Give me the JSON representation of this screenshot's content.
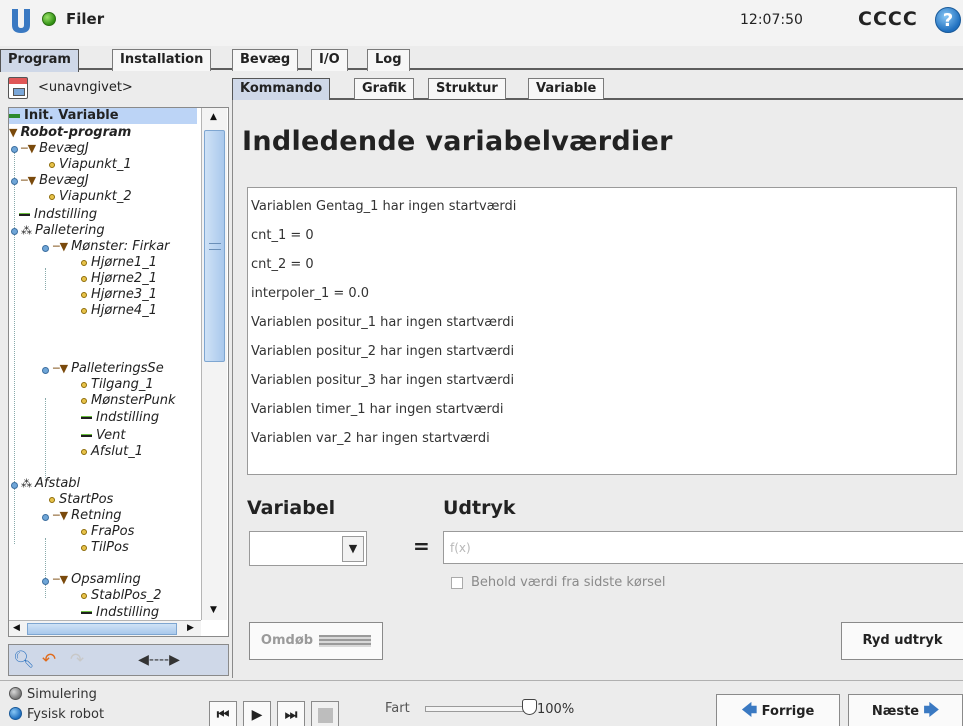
{
  "header": {
    "app_title": "Filer",
    "clock": "12:07:50",
    "robot_name": "CCCC",
    "help_label": "?"
  },
  "main_tabs": [
    {
      "label": "Program",
      "active": true
    },
    {
      "label": "Installation",
      "active": false
    },
    {
      "label": "Bevæg",
      "active": false
    },
    {
      "label": "I/O",
      "active": false
    },
    {
      "label": "Log",
      "active": false
    }
  ],
  "left_panel": {
    "program_name": "<unavngivet>",
    "tree": [
      {
        "label": "Init. Variable",
        "type": "init"
      },
      {
        "label": "Robot-program",
        "type": "folder-root"
      },
      {
        "label": "BevægJ",
        "type": "folder"
      },
      {
        "label": "Viapunkt_1",
        "type": "point"
      },
      {
        "label": "BevægJ",
        "type": "folder"
      },
      {
        "label": "Viapunkt_2",
        "type": "point"
      },
      {
        "label": "Indstilling",
        "type": "bar"
      },
      {
        "label": "Palletering",
        "type": "pallet"
      },
      {
        "label": "Mønster: Firkar",
        "type": "folder"
      },
      {
        "label": "Hjørne1_1",
        "type": "point"
      },
      {
        "label": "Hjørne2_1",
        "type": "point"
      },
      {
        "label": "Hjørne3_1",
        "type": "point"
      },
      {
        "label": "Hjørne4_1",
        "type": "point"
      },
      {
        "label": "PalleteringsSe",
        "type": "folder"
      },
      {
        "label": "Tilgang_1",
        "type": "point"
      },
      {
        "label": "MønsterPunk",
        "type": "point"
      },
      {
        "label": "Indstilling",
        "type": "bar"
      },
      {
        "label": "Vent",
        "type": "bar"
      },
      {
        "label": "Afslut_1",
        "type": "point"
      },
      {
        "label": "Afstabl",
        "type": "pallet"
      },
      {
        "label": "StartPos",
        "type": "point"
      },
      {
        "label": "Retning",
        "type": "folder"
      },
      {
        "label": "FraPos",
        "type": "point"
      },
      {
        "label": "TilPos",
        "type": "point"
      },
      {
        "label": "Opsamling",
        "type": "folder"
      },
      {
        "label": "StablPos_2",
        "type": "point"
      },
      {
        "label": "Indstilling",
        "type": "bar"
      }
    ]
  },
  "sub_tabs": [
    {
      "label": "Kommando",
      "active": true
    },
    {
      "label": "Grafik",
      "active": false
    },
    {
      "label": "Struktur",
      "active": false
    },
    {
      "label": "Variable",
      "active": false
    }
  ],
  "content": {
    "heading": "Indledende variabelværdier",
    "variables": [
      "Variablen Gentag_1 har ingen startværdi",
      "cnt_1 = 0",
      "cnt_2 = 0",
      "interpoler_1 = 0.0",
      "Variablen positur_1 har ingen startværdi",
      "Variablen positur_2 har ingen startværdi",
      "Variablen positur_3 har ingen startværdi",
      "Variablen timer_1 har ingen startværdi",
      "Variablen var_2 har ingen startværdi"
    ],
    "variable_label": "Variabel",
    "expression_label": "Udtryk",
    "equals": "=",
    "expression_placeholder": "f(x)",
    "variable_value": "",
    "keep_value_label": "Behold værdi fra sidste kørsel",
    "rename_button": "Omdøb",
    "clear_button": "Ryd udtryk"
  },
  "footer": {
    "simulation_label": "Simulering",
    "physical_label": "Fysisk robot",
    "speed_label": "Fart",
    "speed_value": "100%",
    "speed_fraction": 1.0,
    "prev_button": "Forrige",
    "next_button": "Næste"
  },
  "colors": {
    "accent": "#cfd8e8",
    "selection": "#bcd4f6",
    "status_dot": "#3aa31a",
    "help": "#1f6fbf"
  }
}
